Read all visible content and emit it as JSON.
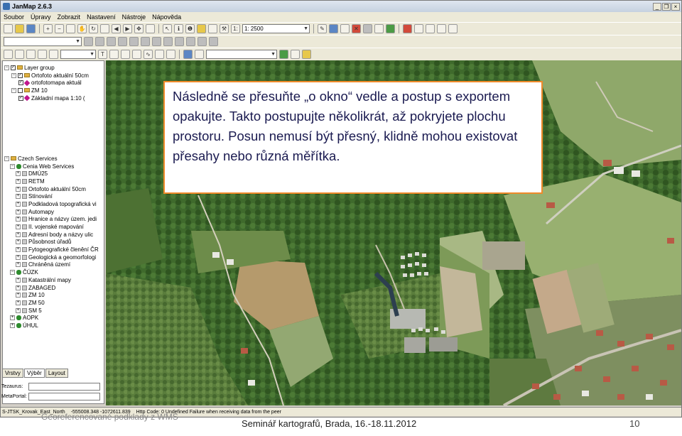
{
  "window": {
    "title": "JanMap 2.6.3",
    "controls": [
      "_",
      "❐",
      "×"
    ]
  },
  "menu": [
    "Soubor",
    "Úpravy",
    "Zobrazit",
    "Nastavení",
    "Nástroje",
    "Nápověda"
  ],
  "toolbar": {
    "scale_value": "1: 2500",
    "row1_icons": [
      "new-file-icon",
      "open-folder-icon",
      "save-icon",
      "print-icon",
      "zoom-in-icon",
      "zoom-out-icon",
      "pan-hand-icon",
      "refresh-icon",
      "identify-icon",
      "back-icon",
      "forward-icon",
      "fullextent-icon"
    ],
    "row3_combo": ""
  },
  "layers": {
    "group_label": "Layer group",
    "items": [
      {
        "label": "Ortofoto aktuální 50cm",
        "indent": 1,
        "type": "layer",
        "checked": true,
        "expanded": true
      },
      {
        "label": "ortofotomapa aktuál",
        "indent": 2,
        "type": "pin",
        "checked": true,
        "expanded": false
      },
      {
        "label": "ZM 10",
        "indent": 1,
        "type": "layer",
        "checked": false,
        "expanded": true
      },
      {
        "label": "Základní mapa 1:10 (",
        "indent": 2,
        "type": "pin",
        "checked": true,
        "expanded": false
      }
    ]
  },
  "services": {
    "root_label": "Czech Services",
    "items": [
      {
        "label": "Cenia Web Services",
        "level": 1,
        "color": "#2e8b2e",
        "expander": "−"
      },
      {
        "label": "DMÚ25",
        "level": 2,
        "color": "#c9c9c9",
        "expander": "+"
      },
      {
        "label": "RETM",
        "level": 2,
        "color": "#c9c9c9",
        "expander": "+"
      },
      {
        "label": "Ortofoto aktuální 50cm",
        "level": 2,
        "color": "#c9c9c9",
        "expander": "+"
      },
      {
        "label": "Stínování",
        "level": 2,
        "color": "#c9c9c9",
        "expander": "+"
      },
      {
        "label": "Podkladová topografická vi",
        "level": 2,
        "color": "#c9c9c9",
        "expander": "+"
      },
      {
        "label": "Automapy",
        "level": 2,
        "color": "#c9c9c9",
        "expander": "+"
      },
      {
        "label": "Hranice a názvy územ. jedi",
        "level": 2,
        "color": "#c9c9c9",
        "expander": "+"
      },
      {
        "label": "II. vojenské mapování",
        "level": 2,
        "color": "#c9c9c9",
        "expander": "+"
      },
      {
        "label": "Adresní body a názvy ulic",
        "level": 2,
        "color": "#c9c9c9",
        "expander": "+"
      },
      {
        "label": "Působnost úřadů",
        "level": 2,
        "color": "#c9c9c9",
        "expander": "+"
      },
      {
        "label": "Fytogeografické členění ČR",
        "level": 2,
        "color": "#c9c9c9",
        "expander": "+"
      },
      {
        "label": "Geologická a geomorfologi",
        "level": 2,
        "color": "#c9c9c9",
        "expander": "+"
      },
      {
        "label": "Chráněná území",
        "level": 2,
        "color": "#c9c9c9",
        "expander": "+"
      },
      {
        "label": "ČÚZK",
        "level": 1,
        "color": "#2e8b2e",
        "expander": "−"
      },
      {
        "label": "Katastrální mapy",
        "level": 2,
        "color": "#c9c9c9",
        "expander": "+"
      },
      {
        "label": "ZABAGED",
        "level": 2,
        "color": "#c9c9c9",
        "expander": "+"
      },
      {
        "label": "ZM 10",
        "level": 2,
        "color": "#c9c9c9",
        "expander": "+"
      },
      {
        "label": "ZM 50",
        "level": 2,
        "color": "#c9c9c9",
        "expander": "+"
      },
      {
        "label": "SM 5",
        "level": 2,
        "color": "#c9c9c9",
        "expander": "+"
      },
      {
        "label": "AOPK",
        "level": 1,
        "color": "#2e8b2e",
        "expander": "+"
      },
      {
        "label": "ÚHUL",
        "level": 1,
        "color": "#2e8b2e",
        "expander": "+"
      }
    ]
  },
  "tabs": [
    "Vrstvy",
    "Výběr",
    "Layout"
  ],
  "fields": [
    {
      "label": "Tezaurus:",
      "value": ""
    },
    {
      "label": "MetaPortal:",
      "value": ""
    }
  ],
  "status": {
    "crs": "S-JTSK_Krovak_East_North",
    "coords": "-555008.348 -1072611.839",
    "message": "Http Code: 0 Undefined  Failure when receiving data from the peer"
  },
  "callout_text": "Následně se přesuňte „o okno“ vedle a postup s exportem opakujte. Takto postupujte několikrát, až pokryjete plochu prostoru. Posun nemusí být přesný, klidně mohou existovat přesahy nebo různá měřítka.",
  "footer": {
    "left": "Georeferencované podklady z WMS",
    "center": "Seminář kartografů, Brada, 16.-18.11.2012",
    "page": "10"
  },
  "colors": {
    "callout_border": "#f08a2a",
    "callout_text": "#1a1a50"
  }
}
